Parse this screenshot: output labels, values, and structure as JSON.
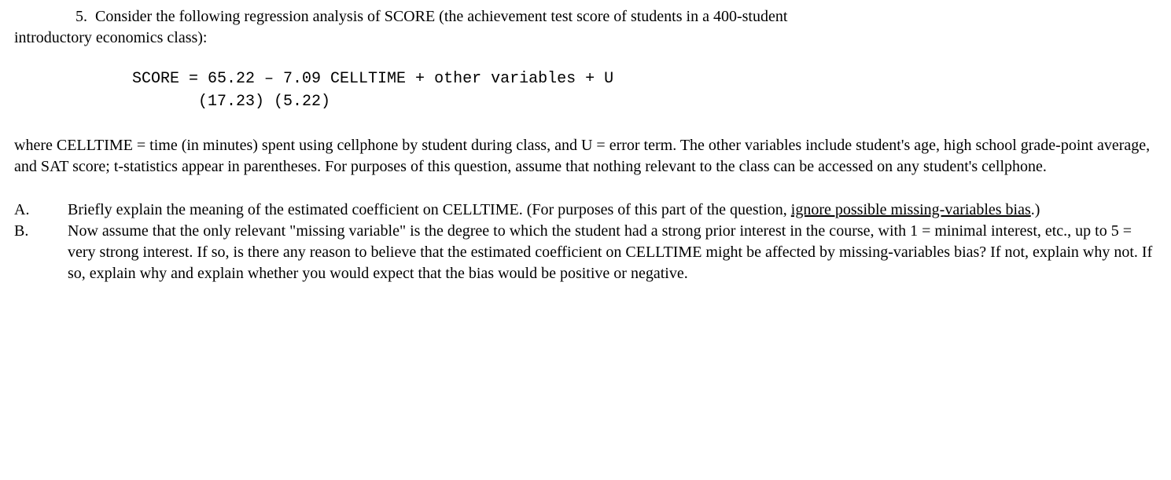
{
  "intro": {
    "number": "5.",
    "text_before": "Consider the following regression analysis of SCORE (the achievement test score of students in a 400-student",
    "text_after": "introductory economics class):"
  },
  "equation": {
    "line1": "SCORE = 65.22 – 7.09 CELLTIME + other variables + U",
    "line2": "       (17.23) (5.22)"
  },
  "description": "where CELLTIME = time (in minutes) spent using cellphone by student during class, and U = error term.  The other variables include student's age, high school grade-point average, and SAT score; t-statistics appear in parentheses.  For purposes of this question, assume that nothing relevant to the class can be accessed on any student's cellphone.",
  "questions": {
    "A": {
      "label": "A.",
      "part1": "Briefly explain the meaning of the estimated coefficient on CELLTIME.  (For purposes of this part of the question, ",
      "underlined": "ignore possible missing-variables bias",
      "part2": ".)"
    },
    "B": {
      "label": "B.",
      "text": "Now assume that the only relevant \"missing variable\" is the degree to which the student had a strong prior interest in the course, with 1 = minimal interest, etc., up to 5 = very strong interest.  If so, is there any reason to believe that the estimated coefficient on CELLTIME might be affected by missing-variables bias?  If not, explain why not.  If so, explain why and explain whether you would expect that the bias would be positive or negative."
    }
  }
}
